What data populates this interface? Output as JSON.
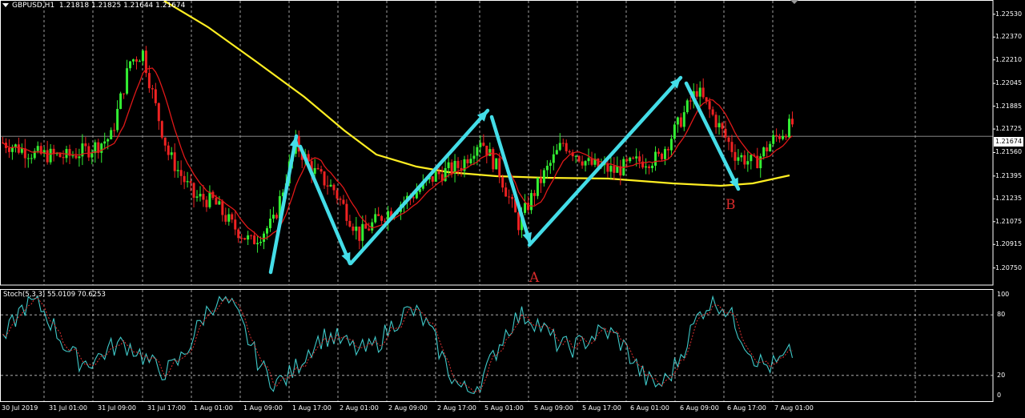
{
  "header": {
    "symbol": "GBPUSD,H1",
    "ohlc": "1.21818 1.21825 1.21644 1.21674"
  },
  "stoch_label": "Stoch(5,3,3) 55.0109 70.6253",
  "current_price": "1.21674",
  "price_axis": {
    "min": 1.2063,
    "max": 1.2263,
    "labels": [
      "1.22530",
      "1.22370",
      "1.22210",
      "1.22045",
      "1.21885",
      "1.21725",
      "1.21560",
      "1.21395",
      "1.21235",
      "1.21075",
      "1.20915",
      "1.20750"
    ]
  },
  "stoch_axis": {
    "labels": [
      "100",
      "80",
      "20",
      "0"
    ],
    "levels": [
      100,
      80,
      20,
      0
    ]
  },
  "time_axis": {
    "labels": [
      "30 Jul 2019",
      "31 Jul 01:00",
      "31 Jul 09:00",
      "31 Jul 17:00",
      "1 Aug 01:00",
      "1 Aug 09:00",
      "1 Aug 17:00",
      "2 Aug 01:00",
      "2 Aug 09:00",
      "2 Aug 17:00",
      "5 Aug 01:00",
      "5 Aug 09:00",
      "5 Aug 17:00",
      "6 Aug 01:00",
      "6 Aug 09:00",
      "6 Aug 17:00",
      "7 Aug 01:00"
    ]
  },
  "annotations": [
    {
      "text": "A"
    },
    {
      "text": "B"
    }
  ],
  "colors": {
    "bull": "#33ee33",
    "bear": "#ee2222",
    "ma_fast": "#e01818",
    "ma_slow": "#ffee22",
    "arrows": "#44dde8",
    "stoch_main": "#3fc9c9",
    "stoch_signal": "#e03030",
    "grid": "#c8c8c8"
  },
  "chart_data": {
    "type": "candlestick",
    "symbol": "GBPUSD",
    "timeframe": "H1",
    "ylim": [
      1.2063,
      1.2263
    ],
    "series": [
      {
        "name": "fast MA",
        "type": "line"
      },
      {
        "name": "slow MA",
        "type": "line"
      }
    ],
    "ma_fast_closes_note": "",
    "stoch_range": [
      0,
      100
    ]
  }
}
